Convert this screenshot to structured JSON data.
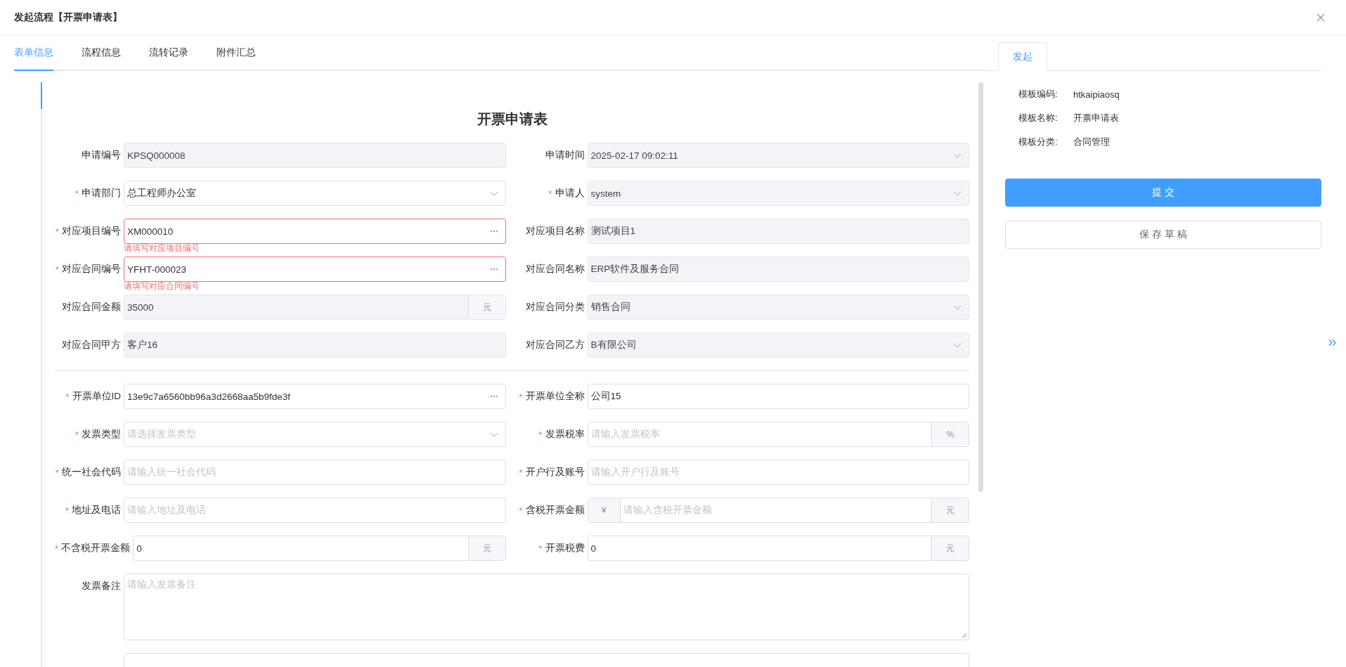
{
  "window": {
    "title": "发起流程【开票申请表】"
  },
  "tabs": [
    {
      "label": "表单信息",
      "selected": true
    },
    {
      "label": "流程信息",
      "selected": false
    },
    {
      "label": "流转记录",
      "selected": false
    },
    {
      "label": "附件汇总",
      "selected": false
    }
  ],
  "form": {
    "title": "开票申请表",
    "sections": [
      {
        "fields": [
          {
            "label": "申请编号",
            "kind": "text",
            "value": "KPSQ000008",
            "disabled": true
          },
          {
            "label": "申请时间",
            "kind": "select",
            "value": "2025-02-17 09:02:11",
            "disabled": true
          },
          {
            "marker": "*",
            "label": "申请部门",
            "kind": "select",
            "value": "总工程师办公室",
            "disabled": false
          },
          {
            "marker": "*",
            "label": "申请人",
            "kind": "select",
            "value": "system",
            "disabled": true
          },
          {
            "marker": "*",
            "label": "对应项目编号",
            "kind": "lookup",
            "value": "XM000010",
            "disabled": false,
            "error": "请填写对应项目编号"
          },
          {
            "label": "对应项目名称",
            "kind": "text",
            "value": "测试项目1",
            "disabled": true
          },
          {
            "marker": "*",
            "label": "对应合同编号",
            "kind": "lookup",
            "value": "YFHT-000023",
            "disabled": false,
            "error": "请填写对应合同编号"
          },
          {
            "label": "对应合同名称",
            "kind": "text",
            "value": "ERP软件及服务合同",
            "disabled": true
          },
          {
            "label": "对应合同金额",
            "kind": "text",
            "value": "35000",
            "suffix": "元",
            "disabled": true
          },
          {
            "label": "对应合同分类",
            "kind": "select",
            "value": "销售合同",
            "disabled": true
          },
          {
            "label": "对应合同甲方",
            "kind": "text",
            "value": "客户16",
            "disabled": true
          },
          {
            "label": "对应合同乙方",
            "kind": "select",
            "value": "B有限公司",
            "disabled": true
          }
        ]
      },
      {
        "fields": [
          {
            "marker": "*",
            "label": "开票单位ID",
            "kind": "lookup",
            "value": "13e9c7a6560bb96a3d2668aa5b9fde3f",
            "disabled": false
          },
          {
            "marker": "*",
            "label": "开票单位全称",
            "kind": "text",
            "value": "公司15",
            "disabled": false
          },
          {
            "marker": "*",
            "label": "发票类型",
            "kind": "select",
            "placeholder": "请选择发票类型",
            "disabled": false
          },
          {
            "marker": "*",
            "label": "发票税率",
            "kind": "text",
            "placeholder": "请输入发票税率",
            "suffix": "%",
            "disabled": false
          },
          {
            "marker": "*",
            "label": "统一社会代码",
            "kind": "text",
            "placeholder": "请输入统一社会代码",
            "disabled": false
          },
          {
            "marker": "*",
            "label": "开户行及账号",
            "kind": "text",
            "placeholder": "请输入开户行及账号",
            "disabled": false
          },
          {
            "marker": "*",
            "label": "地址及电话",
            "kind": "text",
            "placeholder": "请输入地址及电话",
            "disabled": false
          },
          {
            "marker": "*",
            "label": "含税开票金额",
            "kind": "text",
            "prefix": "¥",
            "placeholder": "请输入含税开票金额",
            "suffix": "元",
            "disabled": false
          },
          {
            "marker": "*",
            "label": "不含税开票金额",
            "kind": "text",
            "value": "0",
            "suffix": "元",
            "disabled": false
          },
          {
            "marker": "*",
            "label": "开票税费",
            "kind": "text",
            "value": "0",
            "suffix": "元",
            "disabled": false
          },
          {
            "label": "发票备注",
            "kind": "textarea",
            "placeholder": "请输入发票备注",
            "disabled": false
          },
          {
            "kind": "textarea",
            "disabled": false
          }
        ]
      }
    ]
  },
  "side_panel": {
    "tab": {
      "label": "发起",
      "selected": true
    },
    "info": [
      {
        "label": "模板编码:",
        "value": "htkaipiaosq"
      },
      {
        "label": "模板名称:",
        "value": "开票申请表"
      },
      {
        "label": "模板分类:",
        "value": "合同管理"
      }
    ],
    "buttons": [
      {
        "label": "提 交",
        "kind": "primary"
      },
      {
        "label": "保 存 草 稿",
        "kind": "default"
      }
    ]
  }
}
